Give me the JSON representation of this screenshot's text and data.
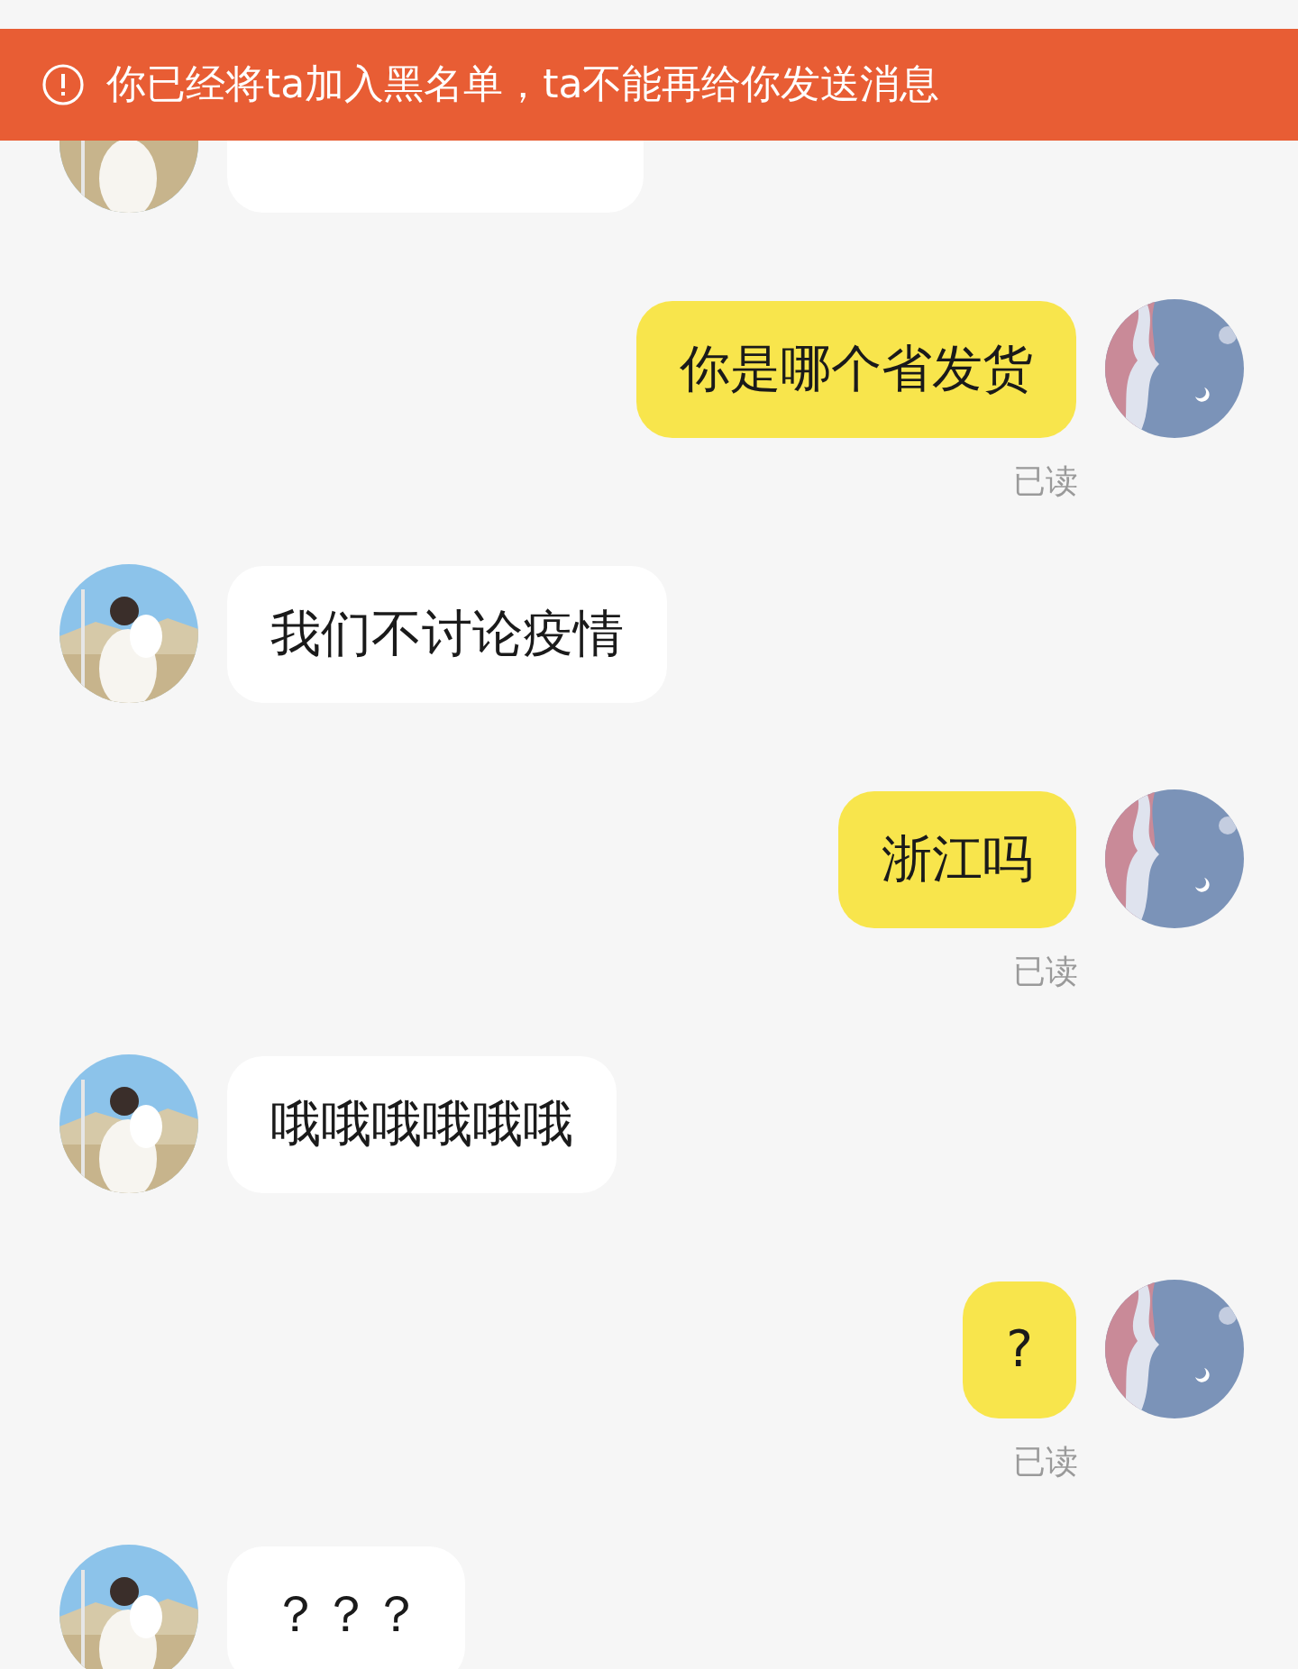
{
  "banner": {
    "text": "你已经将ta加入黑名单，ta不能再给你发送消息"
  },
  "messages": [
    {
      "kind": "clipped"
    },
    {
      "kind": "outgoing",
      "text": "你是哪个省发货",
      "status": "已读"
    },
    {
      "kind": "incoming",
      "text": "我们不讨论疫情"
    },
    {
      "kind": "outgoing",
      "text": "浙江吗",
      "status": "已读"
    },
    {
      "kind": "incoming",
      "text": "哦哦哦哦哦哦"
    },
    {
      "kind": "outgoing",
      "text": "?",
      "status": "已读"
    },
    {
      "kind": "incoming",
      "text": "？？？"
    }
  ]
}
